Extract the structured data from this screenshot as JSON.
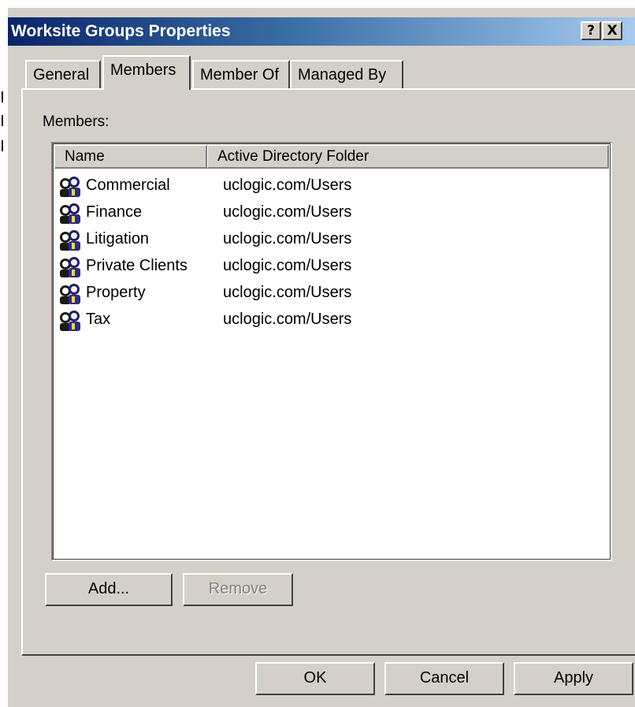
{
  "window": {
    "title": "Worksite Groups Properties",
    "help_label": "?",
    "close_label": "X"
  },
  "tabs": [
    {
      "label": "General",
      "active": false
    },
    {
      "label": "Members",
      "active": true
    },
    {
      "label": "Member Of",
      "active": false
    },
    {
      "label": "Managed By",
      "active": false
    }
  ],
  "members": {
    "section_label": "Members:",
    "columns": [
      "Name",
      "Active Directory Folder"
    ],
    "rows": [
      {
        "name": "Commercial",
        "folder": "uclogic.com/Users",
        "icon": "group-icon"
      },
      {
        "name": "Finance",
        "folder": "uclogic.com/Users",
        "icon": "group-icon"
      },
      {
        "name": "Litigation",
        "folder": "uclogic.com/Users",
        "icon": "group-icon"
      },
      {
        "name": "Private Clients",
        "folder": "uclogic.com/Users",
        "icon": "group-icon"
      },
      {
        "name": "Property",
        "folder": "uclogic.com/Users",
        "icon": "group-icon"
      },
      {
        "name": "Tax",
        "folder": "uclogic.com/Users",
        "icon": "group-icon"
      }
    ],
    "add_label": "Add...",
    "remove_label": "Remove"
  },
  "footer": {
    "ok_label": "OK",
    "cancel_label": "Cancel",
    "apply_label": "Apply"
  },
  "colors": {
    "title_start": "#0a246a",
    "title_end": "#a6caf0",
    "face": "#d4d0c8"
  }
}
